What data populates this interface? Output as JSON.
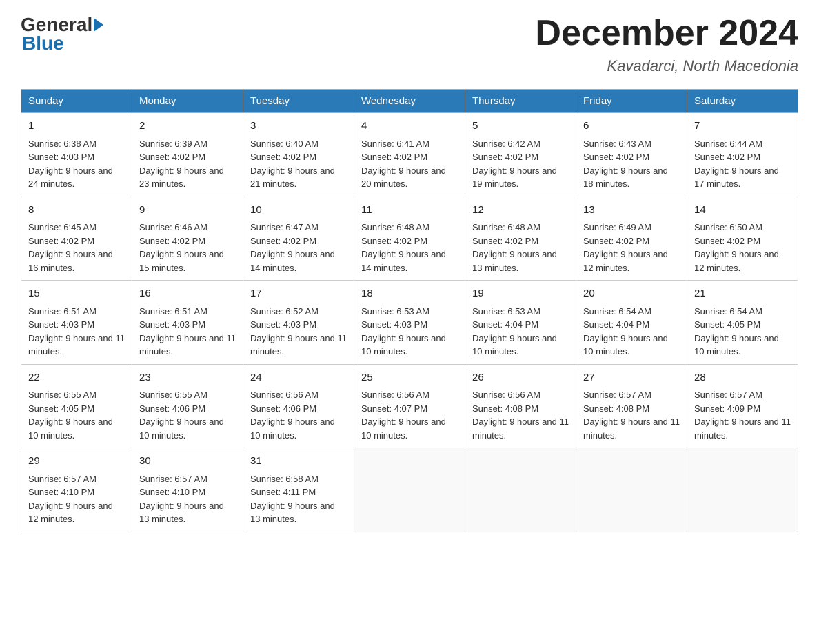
{
  "header": {
    "logo_general": "General",
    "logo_blue": "Blue",
    "month_title": "December 2024",
    "location": "Kavadarci, North Macedonia"
  },
  "days_of_week": [
    "Sunday",
    "Monday",
    "Tuesday",
    "Wednesday",
    "Thursday",
    "Friday",
    "Saturday"
  ],
  "weeks": [
    [
      {
        "day": "1",
        "sunrise": "6:38 AM",
        "sunset": "4:03 PM",
        "daylight": "9 hours and 24 minutes."
      },
      {
        "day": "2",
        "sunrise": "6:39 AM",
        "sunset": "4:02 PM",
        "daylight": "9 hours and 23 minutes."
      },
      {
        "day": "3",
        "sunrise": "6:40 AM",
        "sunset": "4:02 PM",
        "daylight": "9 hours and 21 minutes."
      },
      {
        "day": "4",
        "sunrise": "6:41 AM",
        "sunset": "4:02 PM",
        "daylight": "9 hours and 20 minutes."
      },
      {
        "day": "5",
        "sunrise": "6:42 AM",
        "sunset": "4:02 PM",
        "daylight": "9 hours and 19 minutes."
      },
      {
        "day": "6",
        "sunrise": "6:43 AM",
        "sunset": "4:02 PM",
        "daylight": "9 hours and 18 minutes."
      },
      {
        "day": "7",
        "sunrise": "6:44 AM",
        "sunset": "4:02 PM",
        "daylight": "9 hours and 17 minutes."
      }
    ],
    [
      {
        "day": "8",
        "sunrise": "6:45 AM",
        "sunset": "4:02 PM",
        "daylight": "9 hours and 16 minutes."
      },
      {
        "day": "9",
        "sunrise": "6:46 AM",
        "sunset": "4:02 PM",
        "daylight": "9 hours and 15 minutes."
      },
      {
        "day": "10",
        "sunrise": "6:47 AM",
        "sunset": "4:02 PM",
        "daylight": "9 hours and 14 minutes."
      },
      {
        "day": "11",
        "sunrise": "6:48 AM",
        "sunset": "4:02 PM",
        "daylight": "9 hours and 14 minutes."
      },
      {
        "day": "12",
        "sunrise": "6:48 AM",
        "sunset": "4:02 PM",
        "daylight": "9 hours and 13 minutes."
      },
      {
        "day": "13",
        "sunrise": "6:49 AM",
        "sunset": "4:02 PM",
        "daylight": "9 hours and 12 minutes."
      },
      {
        "day": "14",
        "sunrise": "6:50 AM",
        "sunset": "4:02 PM",
        "daylight": "9 hours and 12 minutes."
      }
    ],
    [
      {
        "day": "15",
        "sunrise": "6:51 AM",
        "sunset": "4:03 PM",
        "daylight": "9 hours and 11 minutes."
      },
      {
        "day": "16",
        "sunrise": "6:51 AM",
        "sunset": "4:03 PM",
        "daylight": "9 hours and 11 minutes."
      },
      {
        "day": "17",
        "sunrise": "6:52 AM",
        "sunset": "4:03 PM",
        "daylight": "9 hours and 11 minutes."
      },
      {
        "day": "18",
        "sunrise": "6:53 AM",
        "sunset": "4:03 PM",
        "daylight": "9 hours and 10 minutes."
      },
      {
        "day": "19",
        "sunrise": "6:53 AM",
        "sunset": "4:04 PM",
        "daylight": "9 hours and 10 minutes."
      },
      {
        "day": "20",
        "sunrise": "6:54 AM",
        "sunset": "4:04 PM",
        "daylight": "9 hours and 10 minutes."
      },
      {
        "day": "21",
        "sunrise": "6:54 AM",
        "sunset": "4:05 PM",
        "daylight": "9 hours and 10 minutes."
      }
    ],
    [
      {
        "day": "22",
        "sunrise": "6:55 AM",
        "sunset": "4:05 PM",
        "daylight": "9 hours and 10 minutes."
      },
      {
        "day": "23",
        "sunrise": "6:55 AM",
        "sunset": "4:06 PM",
        "daylight": "9 hours and 10 minutes."
      },
      {
        "day": "24",
        "sunrise": "6:56 AM",
        "sunset": "4:06 PM",
        "daylight": "9 hours and 10 minutes."
      },
      {
        "day": "25",
        "sunrise": "6:56 AM",
        "sunset": "4:07 PM",
        "daylight": "9 hours and 10 minutes."
      },
      {
        "day": "26",
        "sunrise": "6:56 AM",
        "sunset": "4:08 PM",
        "daylight": "9 hours and 11 minutes."
      },
      {
        "day": "27",
        "sunrise": "6:57 AM",
        "sunset": "4:08 PM",
        "daylight": "9 hours and 11 minutes."
      },
      {
        "day": "28",
        "sunrise": "6:57 AM",
        "sunset": "4:09 PM",
        "daylight": "9 hours and 11 minutes."
      }
    ],
    [
      {
        "day": "29",
        "sunrise": "6:57 AM",
        "sunset": "4:10 PM",
        "daylight": "9 hours and 12 minutes."
      },
      {
        "day": "30",
        "sunrise": "6:57 AM",
        "sunset": "4:10 PM",
        "daylight": "9 hours and 13 minutes."
      },
      {
        "day": "31",
        "sunrise": "6:58 AM",
        "sunset": "4:11 PM",
        "daylight": "9 hours and 13 minutes."
      },
      null,
      null,
      null,
      null
    ]
  ]
}
